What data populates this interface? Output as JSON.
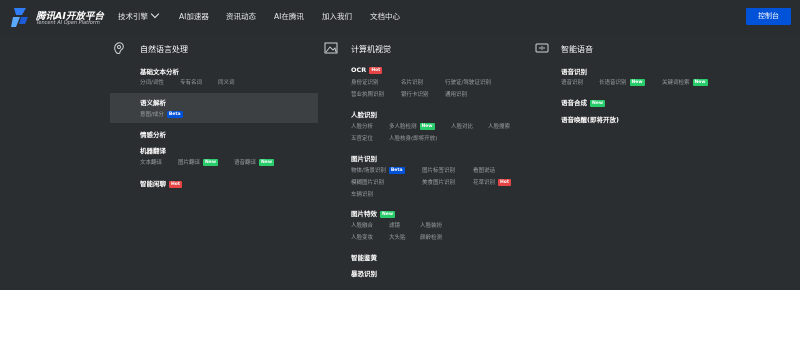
{
  "brand": {
    "title": "腾讯AI开放平台",
    "subtitle": "Tencent AI Open Platform"
  },
  "nav": [
    "技术引擎",
    "AI加速器",
    "资讯动态",
    "AI在腾讯",
    "加入我们",
    "文档中心"
  ],
  "console_label": "控制台",
  "badges": {
    "hot": "Hot",
    "new": "New",
    "beta": "Beta"
  },
  "nlp": {
    "title": "自然语言处理",
    "basic": {
      "title": "基础文本分析",
      "items": [
        "分词/词性",
        "专有名词",
        "同义词"
      ]
    },
    "semantic": {
      "title": "语义解析",
      "items": [
        "意图/成分"
      ]
    },
    "sentiment": {
      "title": "情感分析"
    },
    "mt": {
      "title": "机器翻译",
      "items": [
        "文本翻译",
        "图片翻译",
        "语音翻译"
      ]
    },
    "chat": {
      "title": "智能闲聊"
    }
  },
  "cv": {
    "title": "计算机视觉",
    "ocr": {
      "title": "OCR",
      "items": [
        "身份证识别",
        "名片识别",
        "行驶证/驾驶证识别",
        "营业执照识别",
        "银行卡识别",
        "通用识别"
      ]
    },
    "face": {
      "title": "人脸识别",
      "items": [
        "人脸分析",
        "多人脸检测",
        "人脸对比",
        "人脸搜索",
        "五官定位",
        "人脸核身(即将开放)"
      ]
    },
    "image": {
      "title": "图片识别",
      "items": [
        "物体/场景识别",
        "图片标签识别",
        "看图说话",
        "模糊图片识别",
        "美食图片识别",
        "花草识别",
        "车辆识别"
      ]
    },
    "effects": {
      "title": "图片特效",
      "items": [
        "人脸融合",
        "滤镜",
        "人脸装扮",
        "人脸变妆",
        "大头贴",
        "颜龄检测"
      ]
    },
    "moderation": {
      "title": "智能鉴黄"
    },
    "terror": {
      "title": "暴恐识别"
    }
  },
  "speech": {
    "title": "智能语音",
    "asr": {
      "title": "语音识别",
      "items": [
        "语音识别",
        "长语音识别",
        "关键词检索"
      ]
    },
    "tts": {
      "title": "语音合成"
    },
    "wake": {
      "title": "语音唤醒(即将开放)"
    }
  }
}
